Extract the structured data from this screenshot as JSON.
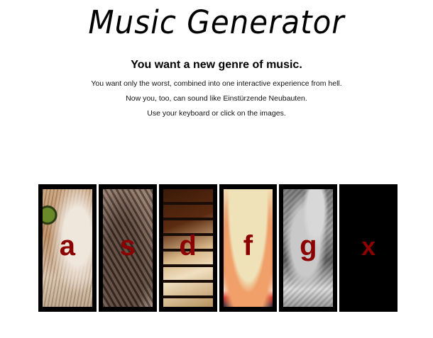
{
  "header": {
    "title": "Music Generator",
    "subtitle": "You want a new genre of music.",
    "lines": [
      "You want only the worst, combined into one interactive experience from hell.",
      "Now you, too, can sound like Einstürzende Neubauten.",
      "Use your keyboard or click on the images."
    ]
  },
  "keys": [
    {
      "letter": "a",
      "image": "cat-closeup"
    },
    {
      "letter": "s",
      "image": "bird-feathers"
    },
    {
      "letter": "d",
      "image": "piano-keys"
    },
    {
      "letter": "f",
      "image": "shouting-face"
    },
    {
      "letter": "g",
      "image": "black-and-white-photo"
    },
    {
      "letter": "x",
      "image": "black-stop"
    }
  ],
  "colors": {
    "letter": "#8b0000",
    "frame": "#000000",
    "background": "#ffffff"
  }
}
